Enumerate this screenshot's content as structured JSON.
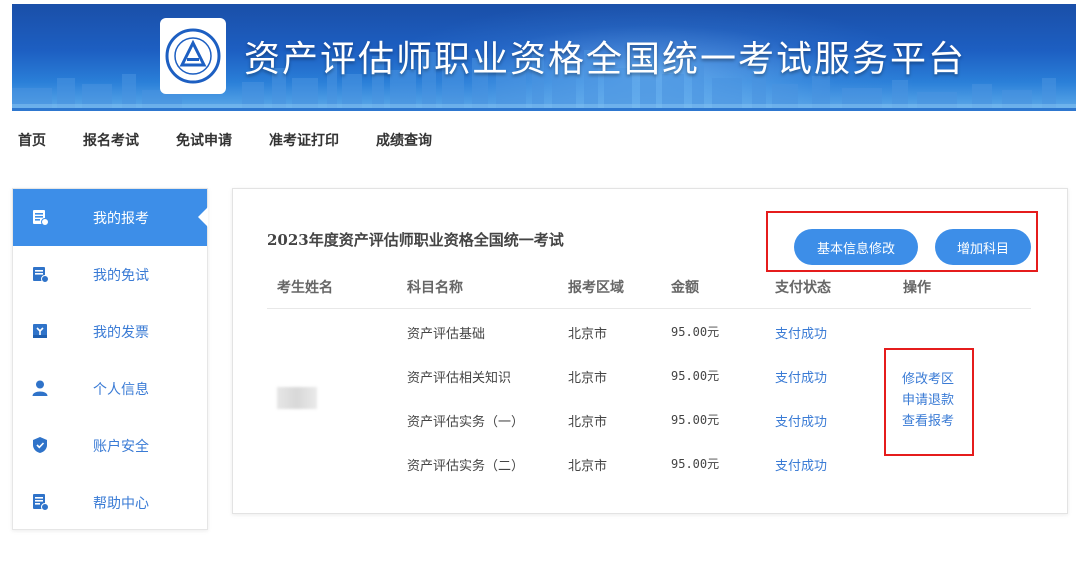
{
  "header": {
    "title": "资产评估师职业资格全国统一考试服务平台",
    "logo_icon": "association-seal-icon"
  },
  "topnav": {
    "items": [
      {
        "label": "首页"
      },
      {
        "label": "报名考试"
      },
      {
        "label": "免试申请"
      },
      {
        "label": "准考证打印"
      },
      {
        "label": "成绩查询"
      }
    ]
  },
  "sidebar": {
    "items": [
      {
        "label": "我的报考",
        "icon": "exam-list-icon",
        "active": true
      },
      {
        "label": "我的免试",
        "icon": "exemption-icon"
      },
      {
        "label": "我的发票",
        "icon": "invoice-icon"
      },
      {
        "label": "个人信息",
        "icon": "user-icon"
      },
      {
        "label": "账户安全",
        "icon": "shield-icon"
      },
      {
        "label": "帮助中心",
        "icon": "help-doc-icon"
      }
    ]
  },
  "main": {
    "exam_title": "2023年度资产评估师职业资格全国统一考试",
    "buttons": {
      "edit_info": "基本信息修改",
      "add_subject": "增加科目"
    },
    "table": {
      "headers": [
        "考生姓名",
        "科目名称",
        "报考区域",
        "金额",
        "支付状态",
        "操作"
      ],
      "rows": [
        {
          "subject": "资产评估基础",
          "region": "北京市",
          "amount": "95.00元",
          "status": "支付成功"
        },
        {
          "subject": "资产评估相关知识",
          "region": "北京市",
          "amount": "95.00元",
          "status": "支付成功"
        },
        {
          "subject": "资产评估实务（一）",
          "region": "北京市",
          "amount": "95.00元",
          "status": "支付成功"
        },
        {
          "subject": "资产评估实务（二）",
          "region": "北京市",
          "amount": "95.00元",
          "status": "支付成功"
        }
      ],
      "operations": [
        "修改考区",
        "申请退款",
        "查看报考"
      ]
    }
  },
  "colors": {
    "accent": "#3d8ee8",
    "link": "#3a7bd5",
    "highlight_border": "#e51c1c",
    "banner": "#1d5fc2"
  }
}
